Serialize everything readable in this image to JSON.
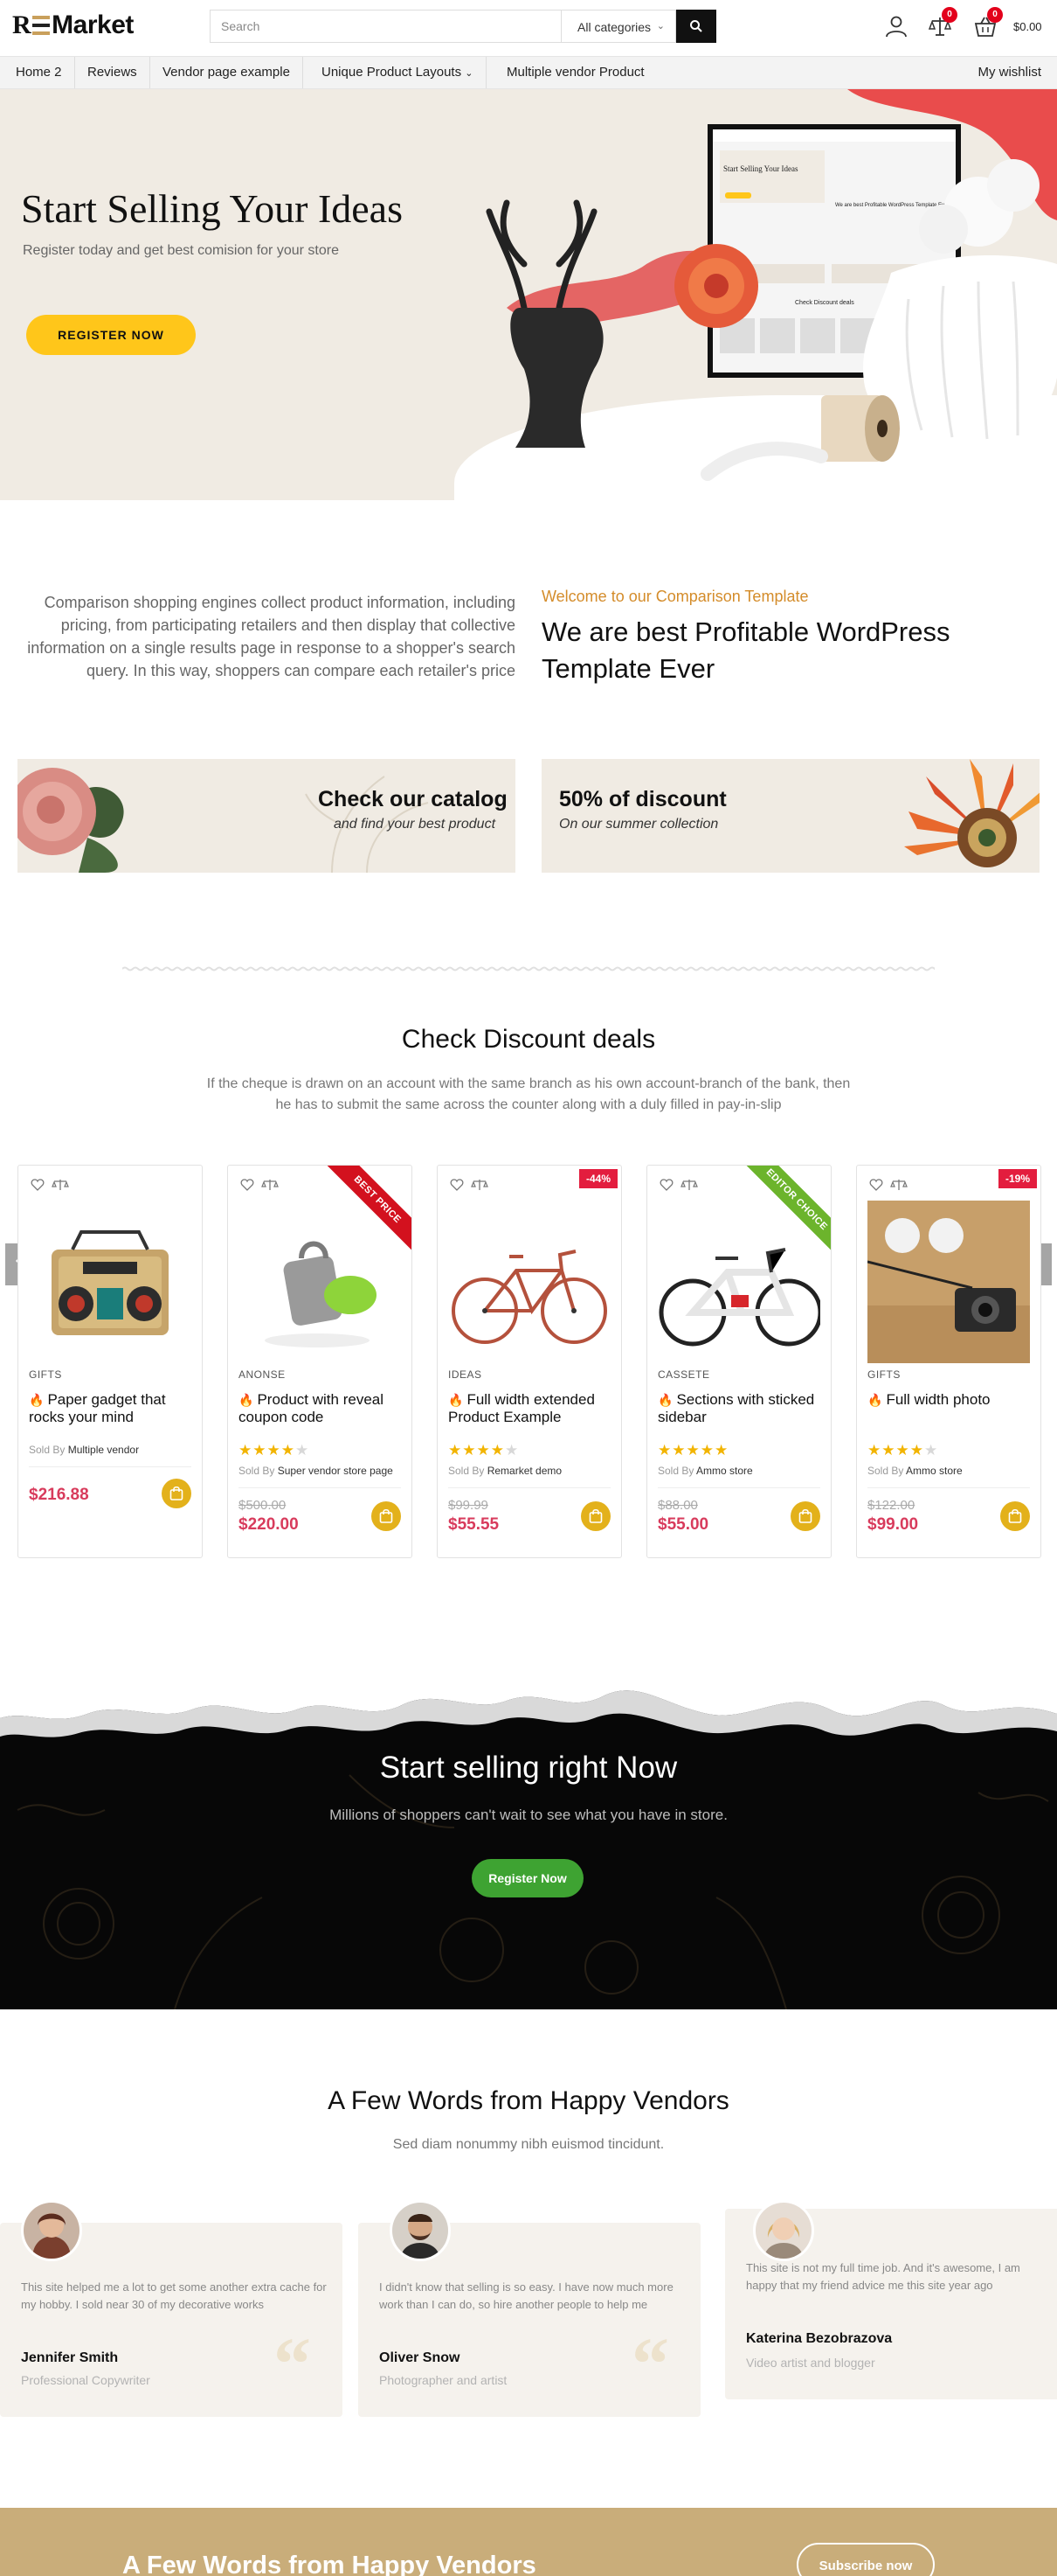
{
  "header": {
    "logo_r": "R",
    "logo_text": "Market",
    "search_placeholder": "Search",
    "category": "All categories",
    "compare_count": "0",
    "cart_count": "0",
    "cart_total": "$0.00"
  },
  "nav": {
    "items": [
      "Home 2",
      "Reviews",
      "Vendor page example",
      "Unique Product Layouts",
      "Multiple vendor Product"
    ],
    "wishlist": "My wishlist"
  },
  "hero": {
    "title": "Start Selling Your Ideas",
    "subtitle": "Register today and get best comision for your store",
    "button": "REGISTER NOW",
    "screen_title": "Start Selling Your Ideas",
    "screen_subtitle": "We are best Profitable WordPress Template Ever",
    "screen_deals": "Check Discount deals"
  },
  "intro": {
    "text": "Comparison shopping engines collect product information, including pricing, from participating retailers and then display that collective information on a single results page in response to a shopper's search query. In this way, shoppers can compare each retailer's price",
    "kicker": "Welcome to our Comparison Template",
    "title": "We are best Profitable WordPress Template Ever"
  },
  "promos": [
    {
      "title": "Check our catalog",
      "subtitle": "and find your best product"
    },
    {
      "title": "50% of discount",
      "subtitle": "On our summer collection"
    }
  ],
  "deals": {
    "title": "Check Discount deals",
    "description": "If the cheque is drawn on an account with the same branch as his own account-branch of the bank, then he has to submit the same across the counter along with a duly filled in pay-in-slip",
    "sold_by_prefix": "Sold By",
    "products": [
      {
        "category": "GIFTS",
        "name": "Paper gadget that rocks your mind",
        "rating": 0,
        "vendor": "Multiple vendor",
        "old_price": "",
        "price": "$216.88",
        "tag": "",
        "ribbon": ""
      },
      {
        "category": "ANONSE",
        "name": "Product with reveal coupon code",
        "rating": 4,
        "vendor": "Super vendor store page",
        "old_price": "$500.00",
        "price": "$220.00",
        "tag": "",
        "ribbon": "BEST PRICE"
      },
      {
        "category": "IDEAS",
        "name": "Full width extended Product Example",
        "rating": 4,
        "vendor": "Remarket demo",
        "old_price": "$99.99",
        "price": "$55.55",
        "tag": "-44%",
        "ribbon": ""
      },
      {
        "category": "CASSETE",
        "name": "Sections with sticked sidebar",
        "rating": 5,
        "vendor": "Ammo store",
        "old_price": "$88.00",
        "price": "$55.00",
        "tag": "",
        "ribbon": "EDITOR CHOICE"
      },
      {
        "category": "GIFTS",
        "name": "Full width photo",
        "rating": 4,
        "vendor": "Ammo store",
        "old_price": "$122.00",
        "price": "$99.00",
        "tag": "-19%",
        "ribbon": ""
      }
    ]
  },
  "cta": {
    "title": "Start selling right Now",
    "subtitle": "Millions of shoppers can't wait to see what you have in store.",
    "button": "Register Now"
  },
  "testimonials": {
    "title": "A Few Words from Happy Vendors",
    "subtitle": "Sed diam nonummy nibh euismod tincidunt.",
    "items": [
      {
        "quote": "This site helped me a lot to get some another extra cache for my hobby. I sold near 30 of my decorative works",
        "name": "Jennifer Smith",
        "role": "Professional Copywriter"
      },
      {
        "quote": "I didn't know that selling is so easy. I have now much more work than I can do, so hire another people to help me",
        "name": "Oliver Snow",
        "role": "Photographer and artist"
      },
      {
        "quote": "This site is not my full time job. And it's awesome, I am happy that my friend advice me this site year ago",
        "name": "Katerina Bezobrazova",
        "role": "Video artist and blogger"
      }
    ]
  },
  "band": {
    "title": "A Few Words from Happy Vendors",
    "button": "Subscribe now"
  },
  "colors": {
    "accent_yellow": "#ffc61a",
    "price_red": "#d83b5c",
    "kicker_orange": "#d48c2a",
    "cta_green": "#3ea332",
    "band_gold": "#c9ad7a"
  }
}
